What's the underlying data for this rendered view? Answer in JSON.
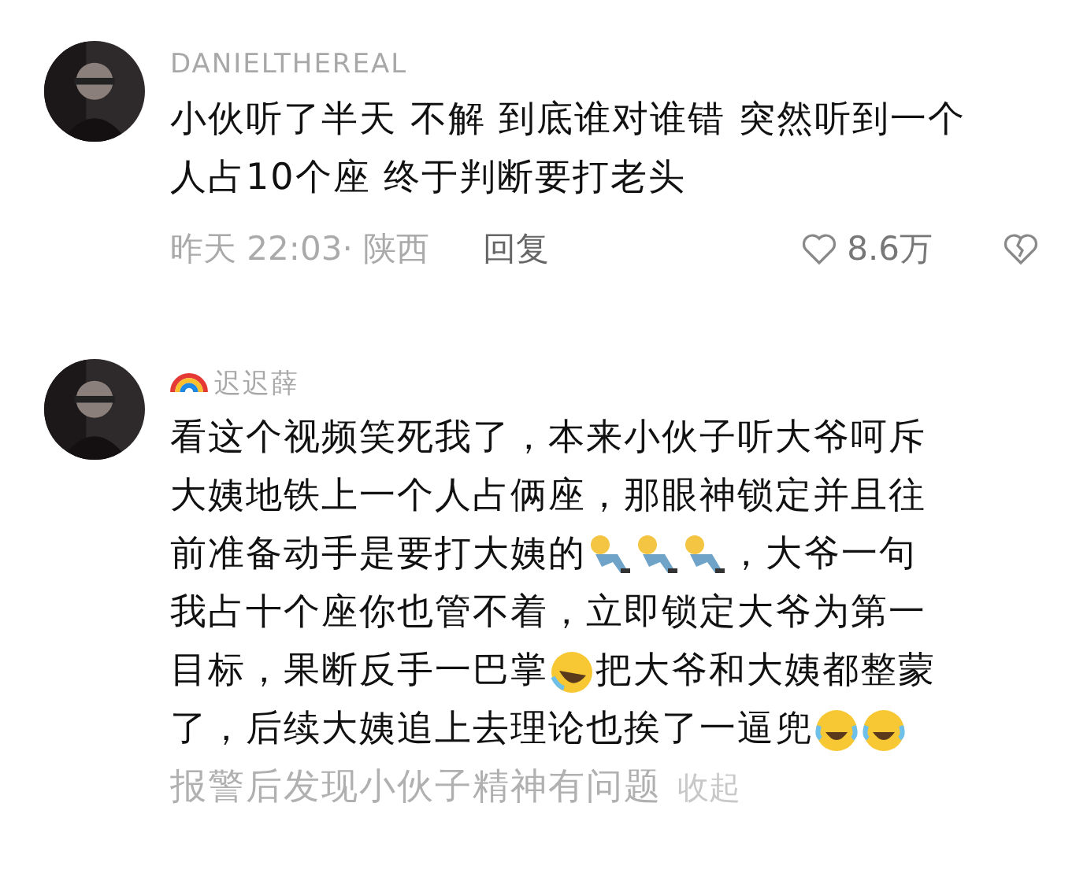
{
  "comments": [
    {
      "username": "DANIELTHEREAL",
      "name_icon": false,
      "avatar": {
        "kind": "picture"
      },
      "lines": [
        [
          {
            "kind": "text",
            "text": "小伙听了半天 不解 到底谁对谁错 突然听到一个"
          }
        ],
        [
          {
            "kind": "text",
            "text": "人占10个座 终于判断要打老头"
          }
        ]
      ],
      "meta": {
        "time_location": "昨天 22:03· 陕西",
        "reply": "回复",
        "likes": "8.6万"
      }
    },
    {
      "username": "迟迟薛",
      "name_icon": true,
      "avatar": {
        "kind": "picture"
      },
      "lines": [
        [
          {
            "kind": "text",
            "text": "看这个视频笑死我了，本来小伙子听大爷呵斥"
          }
        ],
        [
          {
            "kind": "text",
            "text": "大姨地铁上一个人占俩座，那眼神锁定并且往"
          }
        ],
        [
          {
            "kind": "text",
            "text": "前准备动手是要打大姨的"
          },
          {
            "kind": "kneel"
          },
          {
            "kind": "kneel"
          },
          {
            "kind": "kneel"
          },
          {
            "kind": "text",
            "text": "，大爷一句"
          }
        ],
        [
          {
            "kind": "text",
            "text": "我占十个座你也管不着，立即锁定大爷为第一"
          }
        ],
        [
          {
            "kind": "text",
            "text": "目标，果断反手一巴掌"
          },
          {
            "kind": "rolling-laugh"
          },
          {
            "kind": "text",
            "text": "把大爷和大姨都整蒙"
          }
        ],
        [
          {
            "kind": "text",
            "text": "了，后续大姨追上去理论也挨了一逼兜"
          },
          {
            "kind": "cry-laugh"
          },
          {
            "kind": "cry-laugh"
          }
        ]
      ],
      "faded_line": "报警后发现小伙子精神有问题",
      "collapse": "收起"
    }
  ]
}
